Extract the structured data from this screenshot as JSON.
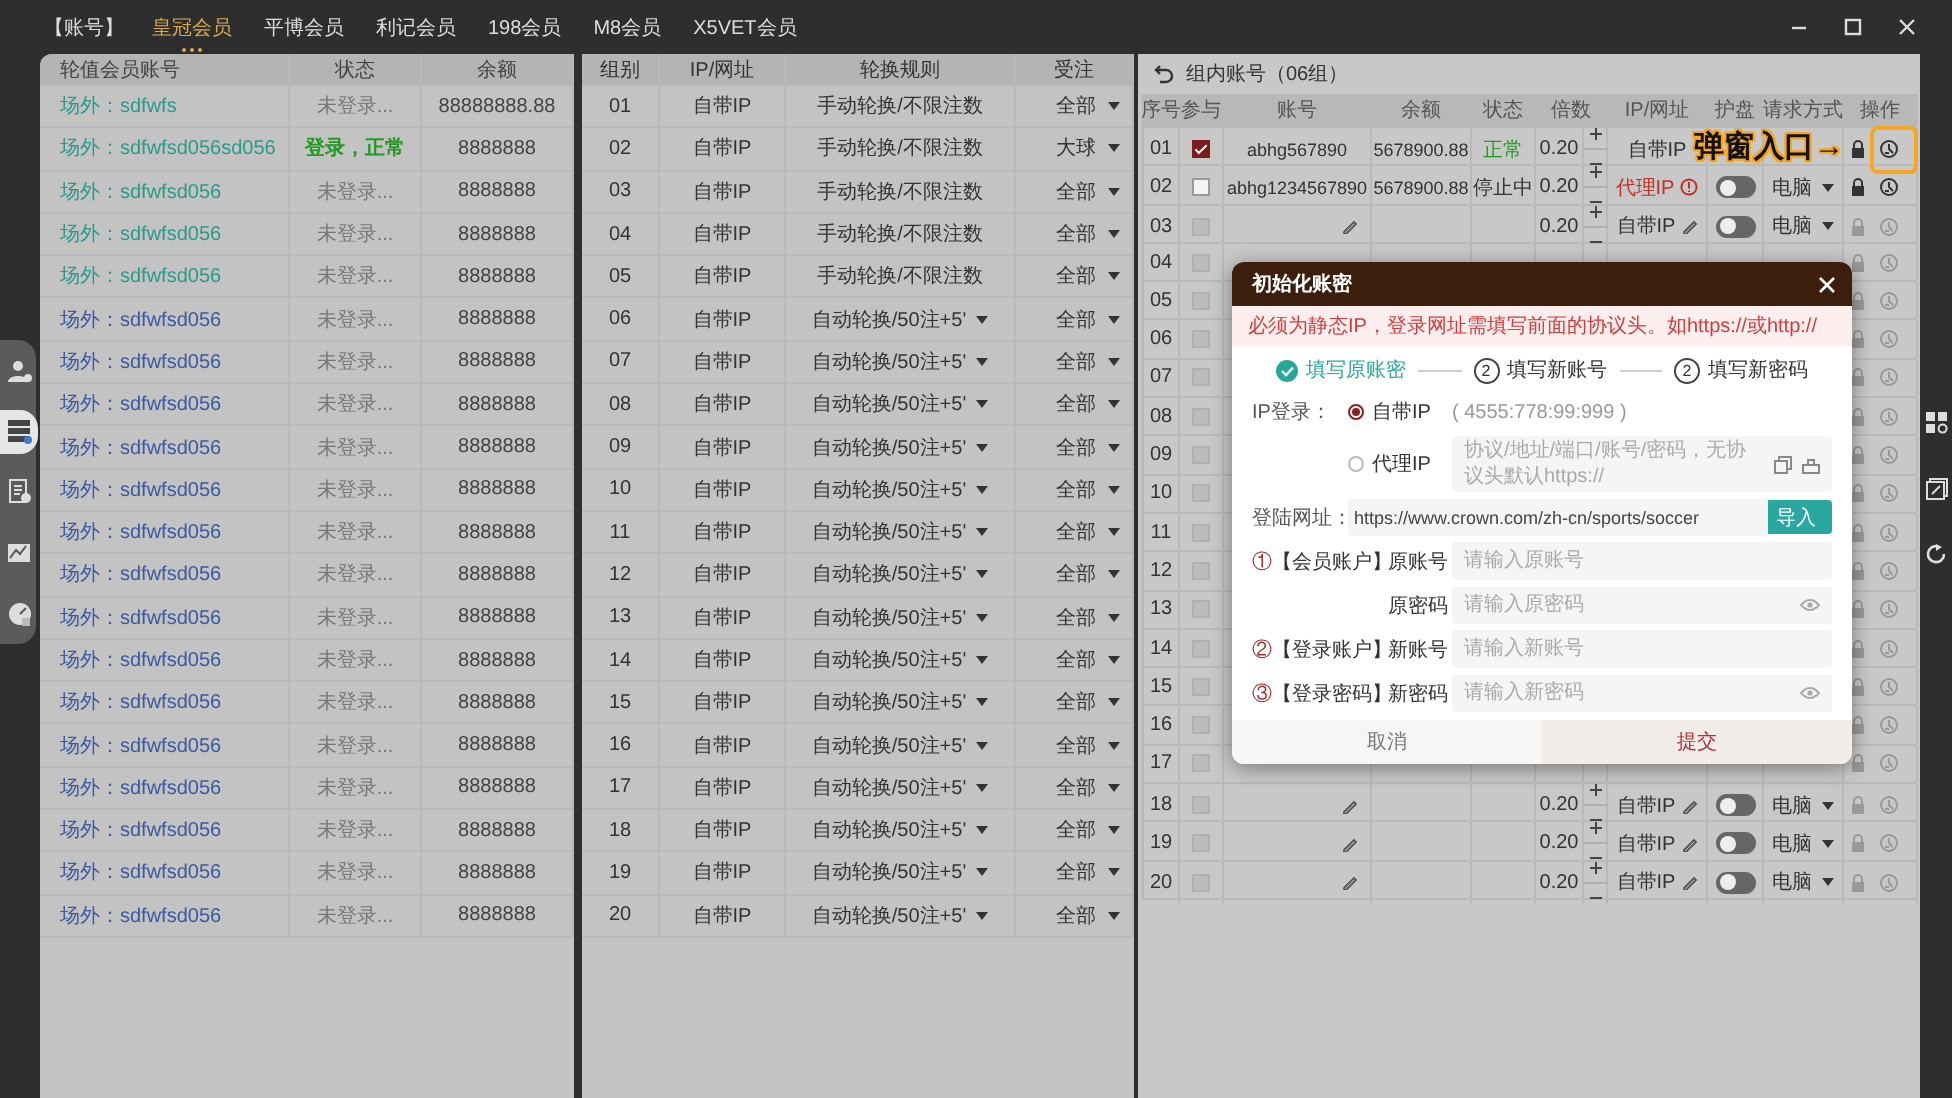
{
  "top_nav": {
    "label": "【账号】",
    "tabs": [
      {
        "label": "皇冠会员",
        "selected": true
      },
      {
        "label": "平博会员",
        "selected": false
      },
      {
        "label": "利记会员",
        "selected": false
      },
      {
        "label": "198会员",
        "selected": false
      },
      {
        "label": "M8会员",
        "selected": false
      },
      {
        "label": "X5VET会员",
        "selected": false
      }
    ]
  },
  "side_nav": [
    {
      "selected": false
    },
    {
      "selected": true
    },
    {
      "selected": false
    },
    {
      "selected": false
    },
    {
      "selected": false
    }
  ],
  "member_table": {
    "columns": [
      "轮值会员账号",
      "状态",
      "余额"
    ],
    "rows": [
      {
        "account": "场外：sdfwfs",
        "color": "#2a9a8a",
        "status": "未登录...",
        "logged_in": false,
        "balance": "88888888.88"
      },
      {
        "account": "场外：sdfwfsd056sd056",
        "color": "#2a9a8a",
        "status": "登录，正常",
        "logged_in": true,
        "balance": "8888888"
      },
      {
        "account": "场外：sdfwfsd056",
        "color": "#2a9a8a",
        "status": "未登录...",
        "logged_in": false,
        "balance": "8888888"
      },
      {
        "account": "场外：sdfwfsd056",
        "color": "#2a9a8a",
        "status": "未登录...",
        "logged_in": false,
        "balance": "8888888"
      },
      {
        "account": "场外：sdfwfsd056",
        "color": "#2a9a8a",
        "status": "未登录...",
        "logged_in": false,
        "balance": "8888888"
      },
      {
        "account": "场外：sdfwfsd056",
        "color": "#3c5aa0",
        "status": "未登录...",
        "logged_in": false,
        "balance": "8888888"
      },
      {
        "account": "场外：sdfwfsd056",
        "color": "#3c5aa0",
        "status": "未登录...",
        "logged_in": false,
        "balance": "8888888"
      },
      {
        "account": "场外：sdfwfsd056",
        "color": "#3c5aa0",
        "status": "未登录...",
        "logged_in": false,
        "balance": "8888888"
      },
      {
        "account": "场外：sdfwfsd056",
        "color": "#3c5aa0",
        "status": "未登录...",
        "logged_in": false,
        "balance": "8888888"
      },
      {
        "account": "场外：sdfwfsd056",
        "color": "#3c5aa0",
        "status": "未登录...",
        "logged_in": false,
        "balance": "8888888"
      },
      {
        "account": "场外：sdfwfsd056",
        "color": "#3c5aa0",
        "status": "未登录...",
        "logged_in": false,
        "balance": "8888888"
      },
      {
        "account": "场外：sdfwfsd056",
        "color": "#3c5aa0",
        "status": "未登录...",
        "logged_in": false,
        "balance": "8888888"
      },
      {
        "account": "场外：sdfwfsd056",
        "color": "#3c5aa0",
        "status": "未登录...",
        "logged_in": false,
        "balance": "8888888"
      },
      {
        "account": "场外：sdfwfsd056",
        "color": "#3c5aa0",
        "status": "未登录...",
        "logged_in": false,
        "balance": "8888888"
      },
      {
        "account": "场外：sdfwfsd056",
        "color": "#3c5aa0",
        "status": "未登录...",
        "logged_in": false,
        "balance": "8888888"
      },
      {
        "account": "场外：sdfwfsd056",
        "color": "#3c5aa0",
        "status": "未登录...",
        "logged_in": false,
        "balance": "8888888"
      },
      {
        "account": "场外：sdfwfsd056",
        "color": "#3c5aa0",
        "status": "未登录...",
        "logged_in": false,
        "balance": "8888888"
      },
      {
        "account": "场外：sdfwfsd056",
        "color": "#3c5aa0",
        "status": "未登录...",
        "logged_in": false,
        "balance": "8888888"
      },
      {
        "account": "场外：sdfwfsd056",
        "color": "#3c5aa0",
        "status": "未登录...",
        "logged_in": false,
        "balance": "8888888"
      },
      {
        "account": "场外：sdfwfsd056",
        "color": "#3c5aa0",
        "status": "未登录...",
        "logged_in": false,
        "balance": "8888888"
      }
    ]
  },
  "group_table": {
    "columns": [
      "组别",
      "IP/网址",
      "轮换规则",
      "受注"
    ],
    "rows": [
      {
        "group": "01",
        "ip": "自带IP",
        "rule": "手动轮换/不限注数",
        "rule_dropdown": false,
        "bet": "全部"
      },
      {
        "group": "02",
        "ip": "自带IP",
        "rule": "手动轮换/不限注数",
        "rule_dropdown": false,
        "bet": "大球"
      },
      {
        "group": "03",
        "ip": "自带IP",
        "rule": "手动轮换/不限注数",
        "rule_dropdown": false,
        "bet": "全部"
      },
      {
        "group": "04",
        "ip": "自带IP",
        "rule": "手动轮换/不限注数",
        "rule_dropdown": false,
        "bet": "全部"
      },
      {
        "group": "05",
        "ip": "自带IP",
        "rule": "手动轮换/不限注数",
        "rule_dropdown": false,
        "bet": "全部"
      },
      {
        "group": "06",
        "ip": "自带IP",
        "rule": "自动轮换/50注+5'",
        "rule_dropdown": true,
        "bet": "全部"
      },
      {
        "group": "07",
        "ip": "自带IP",
        "rule": "自动轮换/50注+5'",
        "rule_dropdown": true,
        "bet": "全部"
      },
      {
        "group": "08",
        "ip": "自带IP",
        "rule": "自动轮换/50注+5'",
        "rule_dropdown": true,
        "bet": "全部"
      },
      {
        "group": "09",
        "ip": "自带IP",
        "rule": "自动轮换/50注+5'",
        "rule_dropdown": true,
        "bet": "全部"
      },
      {
        "group": "10",
        "ip": "自带IP",
        "rule": "自动轮换/50注+5'",
        "rule_dropdown": true,
        "bet": "全部"
      },
      {
        "group": "11",
        "ip": "自带IP",
        "rule": "自动轮换/50注+5'",
        "rule_dropdown": true,
        "bet": "全部"
      },
      {
        "group": "12",
        "ip": "自带IP",
        "rule": "自动轮换/50注+5'",
        "rule_dropdown": true,
        "bet": "全部"
      },
      {
        "group": "13",
        "ip": "自带IP",
        "rule": "自动轮换/50注+5'",
        "rule_dropdown": true,
        "bet": "全部"
      },
      {
        "group": "14",
        "ip": "自带IP",
        "rule": "自动轮换/50注+5'",
        "rule_dropdown": true,
        "bet": "全部"
      },
      {
        "group": "15",
        "ip": "自带IP",
        "rule": "自动轮换/50注+5'",
        "rule_dropdown": true,
        "bet": "全部"
      },
      {
        "group": "16",
        "ip": "自带IP",
        "rule": "自动轮换/50注+5'",
        "rule_dropdown": true,
        "bet": "全部"
      },
      {
        "group": "17",
        "ip": "自带IP",
        "rule": "自动轮换/50注+5'",
        "rule_dropdown": true,
        "bet": "全部"
      },
      {
        "group": "18",
        "ip": "自带IP",
        "rule": "自动轮换/50注+5'",
        "rule_dropdown": true,
        "bet": "全部"
      },
      {
        "group": "19",
        "ip": "自带IP",
        "rule": "自动轮换/50注+5'",
        "rule_dropdown": true,
        "bet": "全部"
      },
      {
        "group": "20",
        "ip": "自带IP",
        "rule": "自动轮换/50注+5'",
        "rule_dropdown": true,
        "bet": "全部"
      }
    ]
  },
  "account_panel": {
    "title": "组内账号（06组）",
    "columns": [
      "序号",
      "参与",
      "账号",
      "余额",
      "状态",
      "倍数",
      "IP/网址",
      "护盘",
      "请求方式",
      "操作"
    ],
    "rows": [
      {
        "no": "01",
        "kind": "filled",
        "checked": true,
        "disabled": false,
        "account": "abhg567890",
        "balance": "5678900.88",
        "status": "正常",
        "status_ok": true,
        "multiplier": "0.20",
        "ip": "自带IP",
        "ip_alert": false
      },
      {
        "no": "02",
        "kind": "filled",
        "checked": false,
        "disabled": false,
        "account": "abhg1234567890",
        "balance": "5678900.88",
        "status": "停止中",
        "status_ok": false,
        "multiplier": "0.20",
        "ip": "代理IP",
        "ip_alert": true,
        "guard_on": false,
        "request": "电脑"
      },
      {
        "no": "03",
        "kind": "empty",
        "checked": false,
        "disabled": true,
        "multiplier": "0.20",
        "ip": "自带IP",
        "ip_alert": false,
        "guard_on": false,
        "request": "电脑"
      },
      {
        "no": "04",
        "kind": "hidden",
        "checked": false,
        "disabled": true
      },
      {
        "no": "05",
        "kind": "hidden",
        "checked": false,
        "disabled": true
      },
      {
        "no": "06",
        "kind": "hidden",
        "checked": false,
        "disabled": true
      },
      {
        "no": "07",
        "kind": "hidden",
        "checked": false,
        "disabled": true
      },
      {
        "no": "08",
        "kind": "hidden",
        "checked": false,
        "disabled": true
      },
      {
        "no": "09",
        "kind": "hidden",
        "checked": false,
        "disabled": true
      },
      {
        "no": "10",
        "kind": "hidden",
        "checked": false,
        "disabled": true
      },
      {
        "no": "11",
        "kind": "hidden",
        "checked": false,
        "disabled": true
      },
      {
        "no": "12",
        "kind": "hidden",
        "checked": false,
        "disabled": true
      },
      {
        "no": "13",
        "kind": "hidden",
        "checked": false,
        "disabled": true
      },
      {
        "no": "14",
        "kind": "hidden",
        "checked": false,
        "disabled": true
      },
      {
        "no": "15",
        "kind": "hidden",
        "checked": false,
        "disabled": true
      },
      {
        "no": "16",
        "kind": "hidden",
        "checked": false,
        "disabled": true
      },
      {
        "no": "17",
        "kind": "hidden",
        "checked": false,
        "disabled": true
      },
      {
        "no": "18",
        "kind": "empty",
        "checked": false,
        "disabled": true,
        "multiplier": "0.20",
        "ip": "自带IP",
        "ip_alert": false,
        "guard_on": false,
        "request": "电脑"
      },
      {
        "no": "19",
        "kind": "empty",
        "checked": false,
        "disabled": true,
        "multiplier": "0.20",
        "ip": "自带IP",
        "ip_alert": false,
        "guard_on": false,
        "request": "电脑"
      },
      {
        "no": "20",
        "kind": "empty",
        "checked": false,
        "disabled": true,
        "multiplier": "0.20",
        "ip": "自带IP",
        "ip_alert": false,
        "guard_on": false,
        "request": "电脑"
      }
    ]
  },
  "annotation": {
    "text": "弹窗入口→"
  },
  "dialog": {
    "title": "初始化账密",
    "notice": "必须为静态IP，登录网址需填写前面的协议头。如https://或http://",
    "steps": [
      {
        "label": "填写原账密",
        "done": true
      },
      {
        "number": "2",
        "label": "填写新账号",
        "done": false
      },
      {
        "number": "2",
        "label": "填写新密码",
        "done": false
      }
    ],
    "ip_login": {
      "label": "IP登录：",
      "options": [
        {
          "label": "自带IP",
          "selected": true,
          "hint": "( 4555:778:99:999 )"
        },
        {
          "label": "代理IP",
          "selected": false,
          "placeholder": "协议/地址/端口/账号/密码，无协议头默认https://"
        }
      ]
    },
    "url": {
      "label": "登陆网址：",
      "value": "https://www.crown.com/zh-cn/sports/soccer",
      "button": "导入"
    },
    "sections": [
      {
        "marker": "①",
        "label": "【会员账户】",
        "fields": [
          {
            "label": "原账号",
            "placeholder": "请输入原账号",
            "secret": false
          },
          {
            "label": "原密码",
            "placeholder": "请输入原密码",
            "secret": true
          }
        ]
      },
      {
        "marker": "②",
        "label": "【登录账户】",
        "fields": [
          {
            "label": "新账号",
            "placeholder": "请输入新账号",
            "secret": false
          }
        ]
      },
      {
        "marker": "③",
        "label": "【登录密码】",
        "fields": [
          {
            "label": "新密码",
            "placeholder": "请输入新密码",
            "secret": true
          }
        ]
      }
    ],
    "buttons": {
      "cancel": "取消",
      "submit": "提交"
    }
  }
}
